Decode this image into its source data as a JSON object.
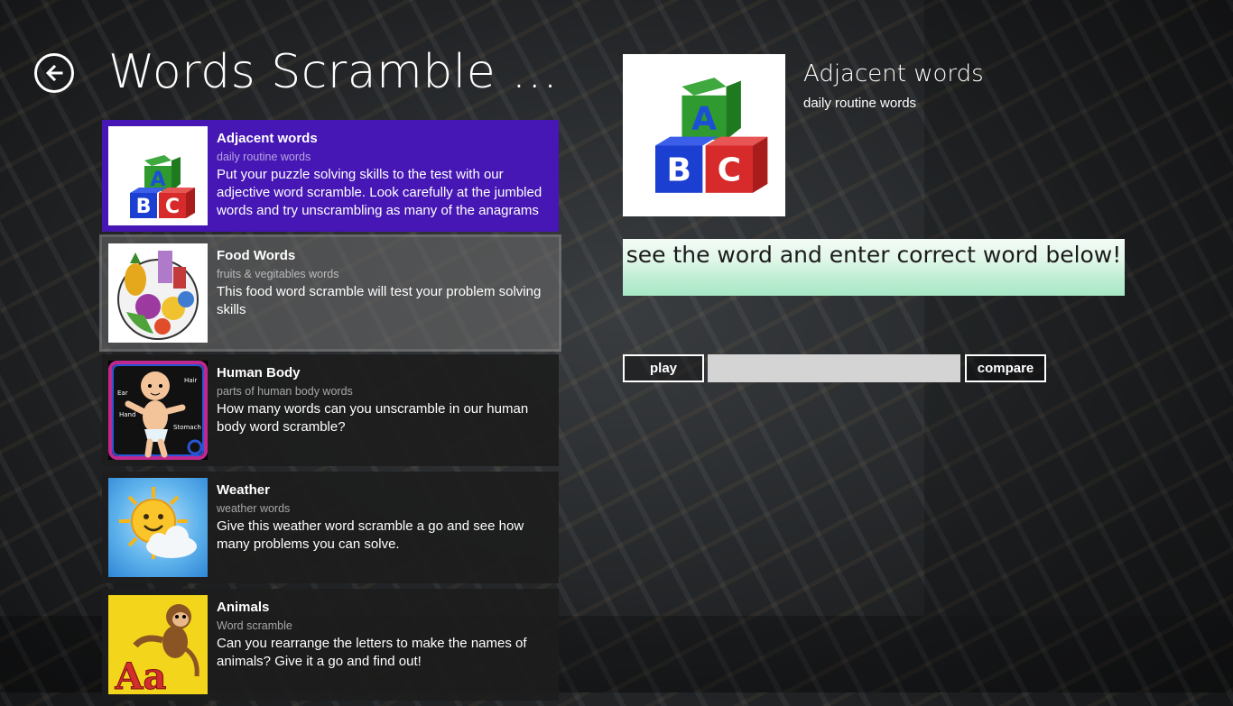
{
  "header": {
    "title": "Words Scramble Ga…"
  },
  "categories": [
    {
      "title": "Adjacent words",
      "subtitle": "daily routine words",
      "description": "Put your puzzle solving skills to the test with our adjective word scramble. Look carefully at the jumbled words and try unscrambling as many of the anagrams",
      "icon": "abc-blocks-icon"
    },
    {
      "title": "Food Words",
      "subtitle": "fruits & vegitables words",
      "description": "This food word scramble will test your problem solving skills",
      "icon": "food-basket-icon"
    },
    {
      "title": "Human Body",
      "subtitle": "parts of human body words",
      "description": "How many words can you unscramble in our human body word scramble?",
      "icon": "baby-body-icon",
      "thumb_labels": {
        "hair": "Hair",
        "ear": "Ear",
        "hand": "Hand",
        "stomach": "Stomach"
      }
    },
    {
      "title": "Weather",
      "subtitle": "weather words",
      "description": "Give this weather word scramble a go and see how many problems you can solve.",
      "icon": "sun-cloud-icon"
    },
    {
      "title": "Animals",
      "subtitle": "Word scramble",
      "description": "Can you rearrange the letters to make the names of animals? Give it a go and find out!",
      "icon": "monkey-letters-icon",
      "thumb_letters": "Aa"
    }
  ],
  "blocks": {
    "a": "A",
    "b": "B",
    "c": "C"
  },
  "detail": {
    "title": "Adjacent words",
    "subtitle": "daily routine words",
    "instruction": "see the word and enter correct word below!",
    "play_label": "play",
    "answer_value": "",
    "compare_label": "compare"
  },
  "colors": {
    "selected": "#4617b4",
    "item_bg": "#1d1d1d",
    "instruction_grad_end": "#a8e8c7"
  }
}
